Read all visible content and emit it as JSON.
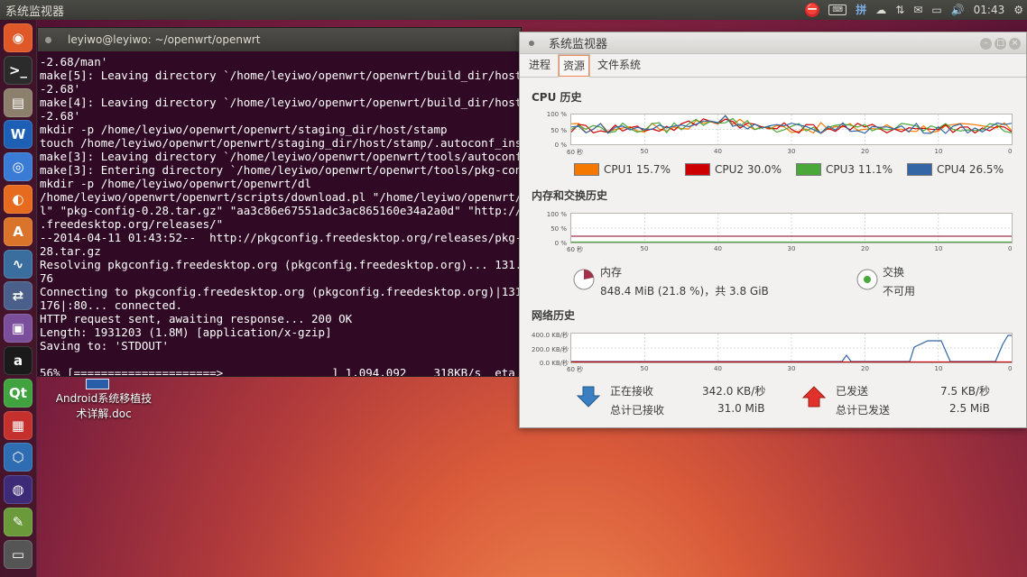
{
  "top_panel": {
    "title": "系统监视器",
    "indicators": [
      "⛔",
      "⌨",
      "拼",
      "☁",
      "⇅",
      "✉",
      "▭",
      "🔊"
    ],
    "time": "01:43"
  },
  "launcher": {
    "items": [
      {
        "name": "ubuntu-dash-icon",
        "glyph": "◉",
        "color": "#e05828"
      },
      {
        "name": "terminal-icon",
        "glyph": ">_",
        "color": "#2b2b2b"
      },
      {
        "name": "file-manager-icon",
        "glyph": "▤",
        "color": "#8c7f6b"
      },
      {
        "name": "wps-writer-icon",
        "glyph": "W",
        "color": "#1d5fb4"
      },
      {
        "name": "chromium-icon",
        "glyph": "◎",
        "color": "#3a7bd5"
      },
      {
        "name": "firefox-icon",
        "glyph": "◐",
        "color": "#e66b1f"
      },
      {
        "name": "software-center-icon",
        "glyph": "A",
        "color": "#d9742a"
      },
      {
        "name": "system-monitor-icon",
        "glyph": "∿",
        "color": "#3a6e9e"
      },
      {
        "name": "network-icon",
        "glyph": "⇄",
        "color": "#4a5f8a"
      },
      {
        "name": "display-icon",
        "glyph": "▣",
        "color": "#7a4e9a"
      },
      {
        "name": "amazon-icon",
        "glyph": "a",
        "color": "#1a1a1a"
      },
      {
        "name": "qt-creator-icon",
        "glyph": "Qt",
        "color": "#41a33f"
      },
      {
        "name": "color-apps-icon",
        "glyph": "▦",
        "color": "#c4302b"
      },
      {
        "name": "virtualbox-icon",
        "glyph": "⬡",
        "color": "#2f6db3"
      },
      {
        "name": "eclipse-icon",
        "glyph": "◍",
        "color": "#3d2b78"
      },
      {
        "name": "text-editor-icon",
        "glyph": "✎",
        "color": "#6a9a3a"
      },
      {
        "name": "disk-icon",
        "glyph": "▭",
        "color": "#555555"
      }
    ]
  },
  "desktop": {
    "doc_label_line1": "Android系统移植技",
    "doc_label_line2": "术详解.doc"
  },
  "terminal": {
    "title": "leyiwo@leyiwo: ~/openwrt/openwrt",
    "output": "-2.68/man'\nmake[5]: Leaving directory `/home/leyiwo/openwrt/openwrt/build_dir/host\n-2.68'\nmake[4]: Leaving directory `/home/leyiwo/openwrt/openwrt/build_dir/host\n-2.68'\nmkdir -p /home/leyiwo/openwrt/openwrt/staging_dir/host/stamp\ntouch /home/leyiwo/openwrt/openwrt/staging_dir/host/stamp/.autoconf_ins\nmake[3]: Leaving directory `/home/leyiwo/openwrt/openwrt/tools/autoconf\nmake[3]: Entering directory `/home/leyiwo/openwrt/openwrt/tools/pkg-con\nmkdir -p /home/leyiwo/openwrt/openwrt/dl\n/home/leyiwo/openwrt/openwrt/scripts/download.pl \"/home/leyiwo/openwrt/\nl\" \"pkg-config-0.28.tar.gz\" \"aa3c86e67551adc3ac865160e34a2a0d\" \"http://\n.freedesktop.org/releases/\"\n--2014-04-11 01:43:52--  http://pkgconfig.freedesktop.org/releases/pkg-\n28.tar.gz\nResolving pkgconfig.freedesktop.org (pkgconfig.freedesktop.org)... 131.\n76\nConnecting to pkgconfig.freedesktop.org (pkgconfig.freedesktop.org)|131\n176|:80... connected.\nHTTP request sent, awaiting response... 200 OK\nLength: 1931203 (1.8M) [application/x-gzip]\nSaving to: 'STDOUT'\n\n56% [=====================>                ] 1,094,092    318KB/s  eta"
  },
  "sysmon": {
    "title": "系统监视器",
    "tabs": [
      "进程",
      "资源",
      "文件系统"
    ],
    "active_tab": 1,
    "cpu": {
      "title": "CPU 历史",
      "y_ticks": [
        "100 %",
        "50 %",
        "0 %"
      ],
      "x_ticks": [
        "60 秒",
        "50",
        "40",
        "30",
        "20",
        "10",
        "0"
      ],
      "legend": [
        {
          "label": "CPU1  15.7%",
          "color": "#f57900"
        },
        {
          "label": "CPU2  30.0%",
          "color": "#cc0000"
        },
        {
          "label": "CPU3  11.1%",
          "color": "#4aa83a"
        },
        {
          "label": "CPU4  26.5%",
          "color": "#3465a4"
        }
      ]
    },
    "memory": {
      "title": "内存和交换历史",
      "y_ticks": [
        "100 %",
        "50 %",
        "0 %"
      ],
      "x_ticks": [
        "60 秒",
        "50",
        "40",
        "30",
        "20",
        "10",
        "0"
      ],
      "mem_label": "内存",
      "mem_value": "848.4 MiB (21.8 %)，共 3.8 GiB",
      "swap_label": "交换",
      "swap_value": "不可用",
      "mem_color": "#a0334a",
      "swap_color": "#4aa83a"
    },
    "network": {
      "title": "网络历史",
      "y_ticks": [
        "400.0 KB/秒",
        "200.0 KB/秒",
        "0.0 KB/秒"
      ],
      "x_ticks": [
        "60 秒",
        "50",
        "40",
        "30",
        "20",
        "10",
        "0"
      ],
      "recv_label": "正在接收",
      "recv_rate": "342.0 KB/秒",
      "recv_total_label": "总计已接收",
      "recv_total": "31.0 MiB",
      "send_label": "已发送",
      "send_rate": "7.5 KB/秒",
      "send_total_label": "总计已发送",
      "send_total": "2.5 MiB",
      "recv_color": "#3465a4",
      "send_color": "#cc0000"
    }
  }
}
